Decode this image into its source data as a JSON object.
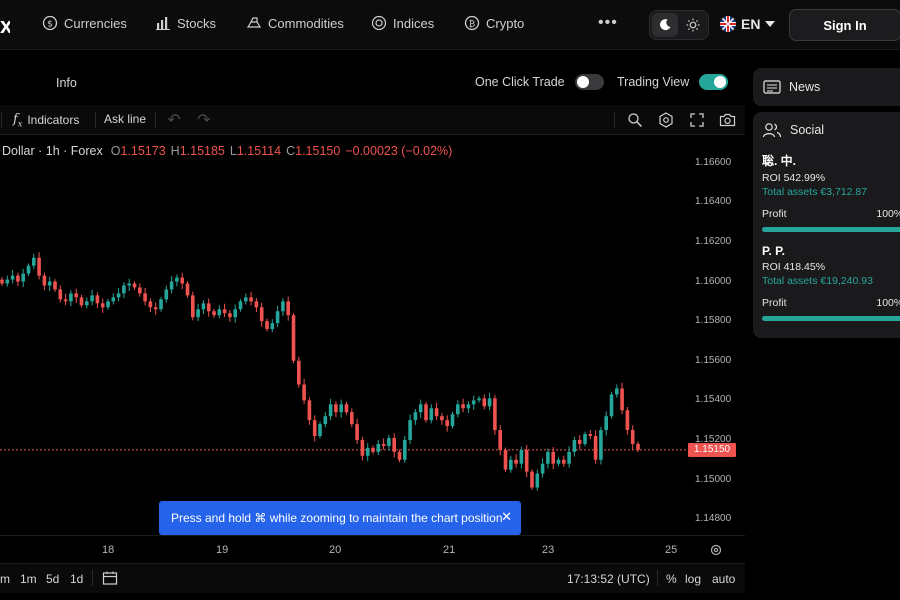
{
  "nav": {
    "logo_fragment": "x",
    "items": [
      {
        "label": "Currencies",
        "icon": "dollar-coin-icon"
      },
      {
        "label": "Stocks",
        "icon": "bar-chart-icon"
      },
      {
        "label": "Commodities",
        "icon": "commodities-icon"
      },
      {
        "label": "Indices",
        "icon": "indices-icon"
      },
      {
        "label": "Crypto",
        "icon": "bitcoin-icon"
      }
    ],
    "language": "EN",
    "signin_label": "Sign In"
  },
  "subbar": {
    "info_label": "Info",
    "one_click_trade_label": "One Click Trade",
    "one_click_trade_on": false,
    "trading_view_label": "Trading View",
    "trading_view_on": true
  },
  "toolbar": {
    "indicators_label": "Indicators",
    "ask_line_label": "Ask line"
  },
  "legend": {
    "symbol": "Dollar · 1h · Forex",
    "open_key": "O",
    "open": "1.15173",
    "high_key": "H",
    "high": "1.15185",
    "low_key": "L",
    "low": "1.15114",
    "close_key": "C",
    "close": "1.15150",
    "change": "−0.00023 (−0.02%)"
  },
  "price_tag": "1.15150",
  "toast": "Press and hold ⌘ while zooming to maintain the chart position",
  "bottombar": {
    "ranges": [
      "m",
      "1m",
      "5d",
      "1d"
    ],
    "clock": "17:13:52 (UTC)",
    "percent": "%",
    "log": "log",
    "auto": "auto"
  },
  "panel": {
    "news_label": "News",
    "social_label": "Social",
    "traders": [
      {
        "name": "聡. 中.",
        "roi": "ROI 542.99%",
        "assets": "Total assets €3,712.87",
        "profit_label": "Profit",
        "profit_pct": "100%/0",
        "profit_fraction": 1.0
      },
      {
        "name": "P. P.",
        "roi": "ROI 418.45%",
        "assets": "Total assets €19,240.93",
        "profit_label": "Profit",
        "profit_pct": "100%/0",
        "profit_fraction": 1.0
      }
    ]
  },
  "colors": {
    "up": "#26a69a",
    "down": "#ef5350",
    "accent_blue": "#2563eb"
  },
  "chart_data": {
    "type": "candlestick",
    "x_ticks": [
      "18",
      "19",
      "20",
      "21",
      "23",
      "25"
    ],
    "y_ticks": [
      "1.16600",
      "1.16400",
      "1.16200",
      "1.16000",
      "1.15800",
      "1.15600",
      "1.15400",
      "1.15200",
      "1.15000",
      "1.14800"
    ],
    "ylim": [
      1.1472,
      1.1674
    ],
    "last_price": 1.1515,
    "close_series": [
      1.1599,
      1.1601,
      1.1603,
      1.16,
      1.1604,
      1.1608,
      1.1612,
      1.1603,
      1.1598,
      1.16,
      1.1596,
      1.1591,
      1.159,
      1.1594,
      1.1592,
      1.1588,
      1.159,
      1.1593,
      1.1589,
      1.1587,
      1.159,
      1.1592,
      1.1594,
      1.1598,
      1.1599,
      1.1597,
      1.1594,
      1.159,
      1.1587,
      1.1586,
      1.1591,
      1.1596,
      1.16,
      1.1602,
      1.1599,
      1.1593,
      1.1582,
      1.1586,
      1.1589,
      1.1585,
      1.1583,
      1.1586,
      1.1584,
      1.1582,
      1.1586,
      1.159,
      1.1592,
      1.159,
      1.1587,
      1.158,
      1.1576,
      1.1579,
      1.1585,
      1.159,
      1.1583,
      1.156,
      1.1548,
      1.154,
      1.153,
      1.1522,
      1.1528,
      1.1532,
      1.1538,
      1.1534,
      1.1538,
      1.1534,
      1.1528,
      1.152,
      1.1512,
      1.1516,
      1.1514,
      1.1518,
      1.1517,
      1.1521,
      1.1514,
      1.151,
      1.152,
      1.153,
      1.1534,
      1.1538,
      1.153,
      1.1536,
      1.1532,
      1.153,
      1.1527,
      1.1533,
      1.1538,
      1.1536,
      1.1538,
      1.154,
      1.1541,
      1.1537,
      1.1541,
      1.1525,
      1.1515,
      1.1505,
      1.151,
      1.1508,
      1.1515,
      1.1504,
      1.1496,
      1.1503,
      1.1508,
      1.1514,
      1.1508,
      1.151,
      1.1508,
      1.1514,
      1.152,
      1.1518,
      1.1523,
      1.1522,
      1.151,
      1.1525,
      1.1532,
      1.1543,
      1.1546,
      1.1535,
      1.1525,
      1.1518,
      1.1515
    ]
  }
}
